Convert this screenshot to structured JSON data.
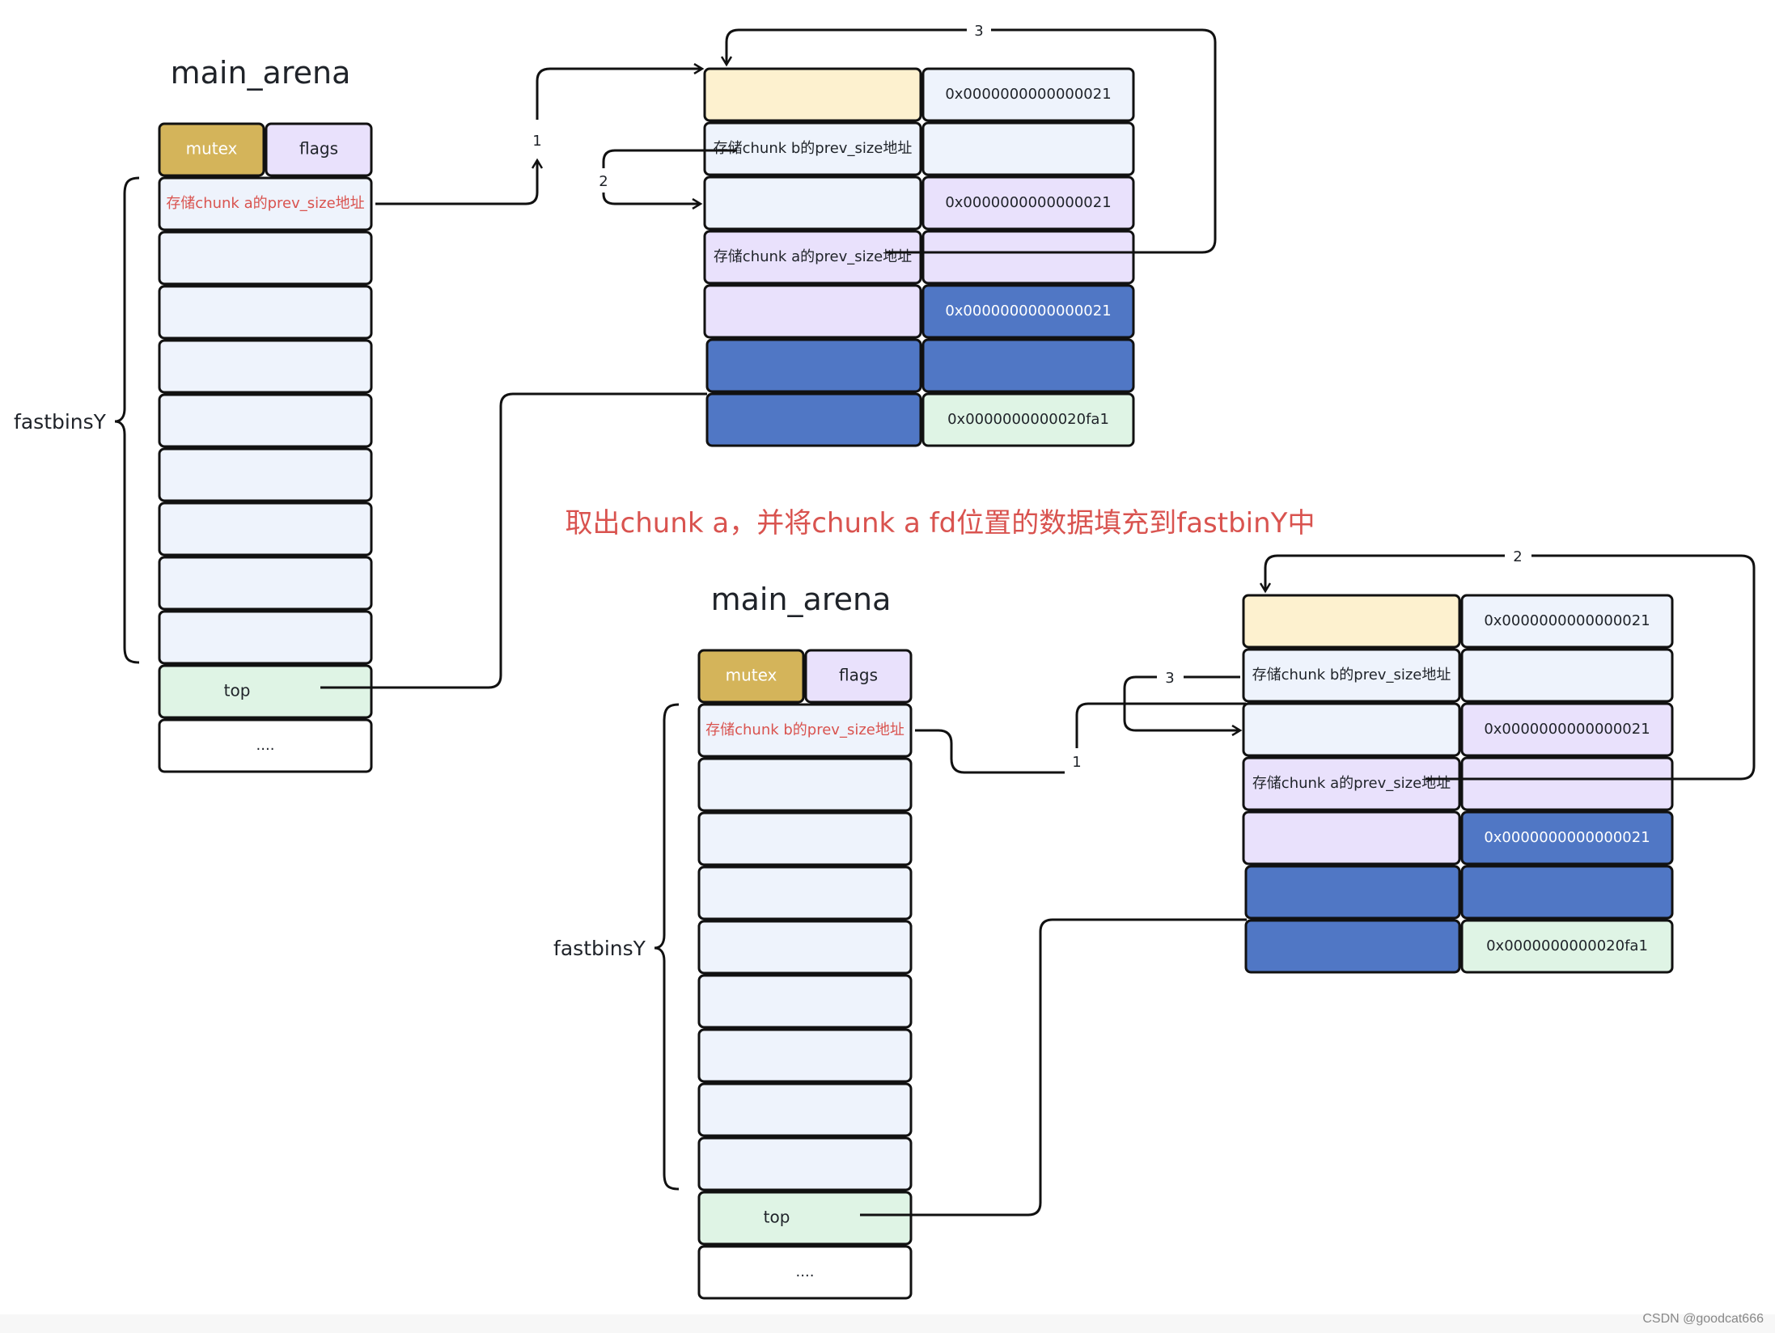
{
  "colors": {
    "mutex": "#d4b45a",
    "flags": "#e9e1fc",
    "bin": "#eef3fc",
    "top": "#dff4e5",
    "plain": "#ffffff",
    "yellow": "#fdf1cf",
    "blue": "#5077c5",
    "caption": "#d9534f",
    "red_text": "#d9534f"
  },
  "diagram1": {
    "title": "main_arena",
    "mutex_label": "mutex",
    "flags_label": "flags",
    "fastbins_label": "fastbinsY",
    "bins": [
      {
        "text": "存储chunk a的prev_size地址",
        "style": "red"
      },
      {
        "text": ""
      },
      {
        "text": ""
      },
      {
        "text": ""
      },
      {
        "text": ""
      },
      {
        "text": ""
      },
      {
        "text": ""
      },
      {
        "text": ""
      },
      {
        "text": ""
      }
    ],
    "top_label": "top",
    "ellipsis_label": "....",
    "chunk_rows": [
      {
        "left": "",
        "left_fill": "yellow",
        "right": "0x0000000000000021",
        "right_fill": "bin"
      },
      {
        "left": "存储chunk b的prev_size地址",
        "left_fill": "bin",
        "right": "",
        "right_fill": "bin"
      },
      {
        "left": "",
        "left_fill": "bin",
        "right": "0x0000000000000021",
        "right_fill": "flags"
      },
      {
        "left": "存储chunk a的prev_size地址",
        "left_fill": "flags",
        "right": "",
        "right_fill": "flags"
      },
      {
        "left": "",
        "left_fill": "flags",
        "right": "0x0000000000000021",
        "right_fill": "blue"
      },
      {
        "left": "",
        "left_fill": "blue",
        "right": "",
        "right_fill": "blue"
      },
      {
        "left": "",
        "left_fill": "blue",
        "right": "0x0000000000020fa1",
        "right_fill": "top"
      }
    ],
    "arrow_labels": {
      "a1": "1",
      "a2": "2",
      "a3": "3"
    }
  },
  "caption": "取出chunk a，并将chunk a fd位置的数据填充到fastbinY中",
  "diagram2": {
    "title": "main_arena",
    "mutex_label": "mutex",
    "flags_label": "flags",
    "fastbins_label": "fastbinsY",
    "bins": [
      {
        "text": "存储chunk b的prev_size地址",
        "style": "red"
      },
      {
        "text": ""
      },
      {
        "text": ""
      },
      {
        "text": ""
      },
      {
        "text": ""
      },
      {
        "text": ""
      },
      {
        "text": ""
      },
      {
        "text": ""
      },
      {
        "text": ""
      }
    ],
    "top_label": "top",
    "ellipsis_label": "....",
    "chunk_rows": [
      {
        "left": "",
        "left_fill": "yellow",
        "right": "0x0000000000000021",
        "right_fill": "bin"
      },
      {
        "left": "存储chunk b的prev_size地址",
        "left_fill": "bin",
        "right": "",
        "right_fill": "bin"
      },
      {
        "left": "",
        "left_fill": "bin",
        "right": "0x0000000000000021",
        "right_fill": "flags"
      },
      {
        "left": "存储chunk a的prev_size地址",
        "left_fill": "flags",
        "right": "",
        "right_fill": "flags"
      },
      {
        "left": "",
        "left_fill": "flags",
        "right": "0x0000000000000021",
        "right_fill": "blue"
      },
      {
        "left": "",
        "left_fill": "blue",
        "right": "",
        "right_fill": "blue"
      },
      {
        "left": "",
        "left_fill": "blue",
        "right": "0x0000000000020fa1",
        "right_fill": "top"
      }
    ],
    "arrow_labels": {
      "a1": "1",
      "a2": "2",
      "a3": "3"
    }
  },
  "watermark": "CSDN @goodcat666"
}
